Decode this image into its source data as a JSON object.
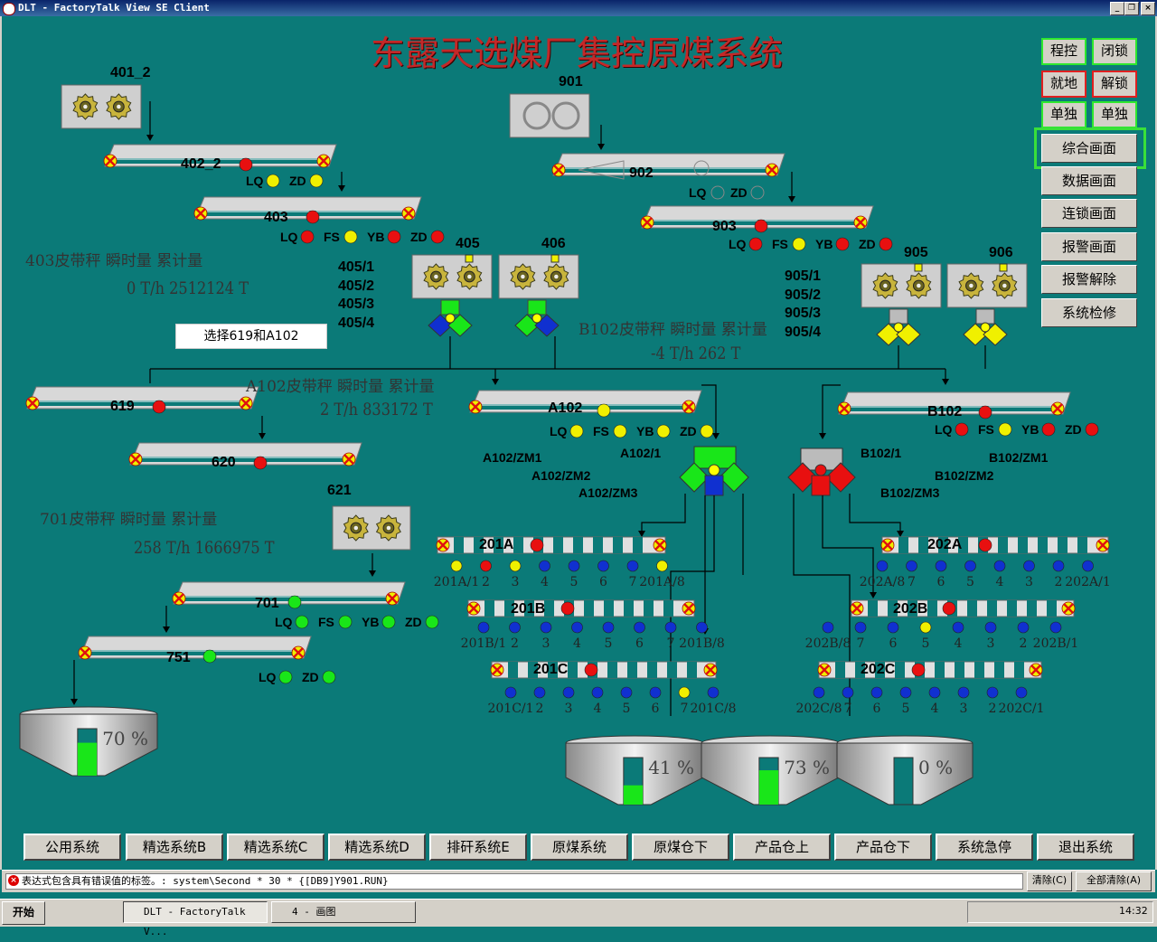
{
  "window": {
    "title": "DLT - FactoryTalk View SE Client",
    "min": "_",
    "max": "❐",
    "close": "×"
  },
  "main_title": "东露天选煤厂集控原煤系统",
  "right_buttons": {
    "chengkong": "程控",
    "bisuo": "闭锁",
    "jiudi": "就地",
    "jiesuo": "解锁",
    "dandu1": "单独",
    "dandu2": "单独"
  },
  "screen_buttons": [
    "综合画面",
    "数据画面",
    "连锁画面",
    "报警画面",
    "报警解除",
    "系统检修"
  ],
  "bottom_buttons": [
    "公用系统",
    "精选系统B",
    "精选系统C",
    "精选系统D",
    "排矸系统E",
    "原煤系统",
    "原煤仓下",
    "产品仓上",
    "产品仓下",
    "系统急停",
    "退出系统"
  ],
  "select_button": "选择619和A102",
  "feeders": {
    "f401_2": "401_2",
    "f901": "901",
    "f405": "405",
    "f406": "406",
    "f905": "905",
    "f906": "906",
    "f621": "621"
  },
  "belts": {
    "b402_2": "402_2",
    "b403": "403",
    "b902": "902",
    "b903": "903",
    "b619": "619",
    "b620": "620",
    "bA102": "A102",
    "bB102": "B102",
    "b701": "701",
    "b751": "751",
    "b201A": "201A",
    "b201B": "201B",
    "b201C": "201C",
    "b202A": "202A",
    "b202B": "202B",
    "b202C": "202C"
  },
  "protect": {
    "lq": "LQ",
    "zd": "ZD",
    "fs": "FS",
    "yb": "YB"
  },
  "scale_403": {
    "label": "403皮带秤  瞬时量     累计量",
    "value": "0   T/h   2512124  T"
  },
  "scale_A102": {
    "label": "A102皮带秤  瞬时量     累计量",
    "value": "2   T/h   833172   T"
  },
  "scale_B102": {
    "label": "B102皮带秤  瞬时量     累计量",
    "value": "-4  T/h   262      T"
  },
  "scale_701": {
    "label": "701皮带秤  瞬时量     累计量",
    "value": "258  T/h   1666975  T"
  },
  "gates_405": [
    "405/1",
    "405/2",
    "405/3",
    "405/4"
  ],
  "gates_905": [
    "905/1",
    "905/2",
    "905/3",
    "905/4"
  ],
  "gates_A102": {
    "g1": "A102/1",
    "zm1": "A102/ZM1",
    "zm2": "A102/ZM2",
    "zm3": "A102/ZM3"
  },
  "gates_B102": {
    "g1": "B102/1",
    "zm1": "B102/ZM1",
    "zm2": "B102/ZM2",
    "zm3": "B102/ZM3"
  },
  "plows_201A": [
    "201A/1",
    "2",
    "3",
    "4",
    "5",
    "6",
    "7",
    "201A/8"
  ],
  "plows_201B": [
    "201B/1",
    "2",
    "3",
    "4",
    "5",
    "6",
    "7",
    "201B/8"
  ],
  "plows_201C": [
    "201C/1",
    "2",
    "3",
    "4",
    "5",
    "6",
    "7",
    "201C/8"
  ],
  "plows_202A": [
    "202A/8",
    "7",
    "6",
    "5",
    "4",
    "3",
    "2",
    "202A/1"
  ],
  "plows_202B": [
    "202B/8",
    "7",
    "6",
    "5",
    "4",
    "3",
    "2",
    "202B/1"
  ],
  "plows_202C": [
    "202C/8",
    "7",
    "6",
    "5",
    "4",
    "3",
    "2",
    "202C/1"
  ],
  "bins": [
    {
      "id": "bin-751",
      "level_pct": 70,
      "label": "70 %"
    },
    {
      "id": "bin-1",
      "level_pct": 41,
      "label": "41 %"
    },
    {
      "id": "bin-2",
      "level_pct": 73,
      "label": "73 %"
    },
    {
      "id": "bin-3",
      "level_pct": 0,
      "label": "0 %"
    }
  ],
  "message": "表达式包含具有错误值的标签。: system\\Second * 30 * {[DB9]Y901.RUN}",
  "msg_clear": "清除(C)",
  "msg_clear_all": "全部清除(A)",
  "taskbar": {
    "start": "开始",
    "task1": "DLT - FactoryTalk V...",
    "task2": "4 - 画图",
    "clock": "14:32"
  },
  "colors": {
    "bg": "#0b7a78",
    "run": "#19e619",
    "stop": "#e81010",
    "warn": "#f0f000",
    "title": "#c42828"
  }
}
